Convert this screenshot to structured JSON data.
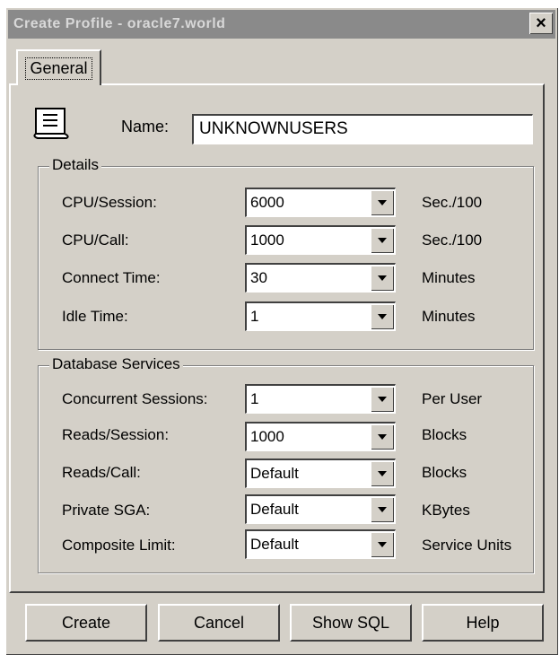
{
  "window": {
    "title": "Create Profile - oracle7.world",
    "close_label": "×"
  },
  "tabs": [
    {
      "label": "General",
      "selected": true
    }
  ],
  "name_field": {
    "label": "Name:",
    "value": "UNKNOWNUSERS"
  },
  "details": {
    "title": "Details",
    "rows": [
      {
        "label": "CPU/Session:",
        "value": "6000",
        "unit": "Sec./100"
      },
      {
        "label": "CPU/Call:",
        "value": "1000",
        "unit": "Sec./100"
      },
      {
        "label": "Connect Time:",
        "value": "30",
        "unit": "Minutes"
      },
      {
        "label": "Idle Time:",
        "value": "1",
        "unit": "Minutes"
      }
    ]
  },
  "database_services": {
    "title": "Database Services",
    "rows": [
      {
        "label": "Concurrent Sessions:",
        "value": "1",
        "unit": "Per User"
      },
      {
        "label": "Reads/Session:",
        "value": "1000",
        "unit": "Blocks"
      },
      {
        "label": "Reads/Call:",
        "value": "Default",
        "unit": "Blocks"
      },
      {
        "label": "Private SGA:",
        "value": "Default",
        "unit": "KBytes"
      },
      {
        "label": "Composite Limit:",
        "value": "Default",
        "unit": "Service Units"
      }
    ]
  },
  "buttons": {
    "create": "Create",
    "cancel": "Cancel",
    "show_sql": "Show SQL",
    "help": "Help"
  },
  "icons": {
    "profile": "profile-document-icon",
    "dropdown": "chevron-down-icon"
  },
  "colors": {
    "dialog_bg": "#d4d0c8",
    "titlebar_bg": "#8a8a8a"
  }
}
